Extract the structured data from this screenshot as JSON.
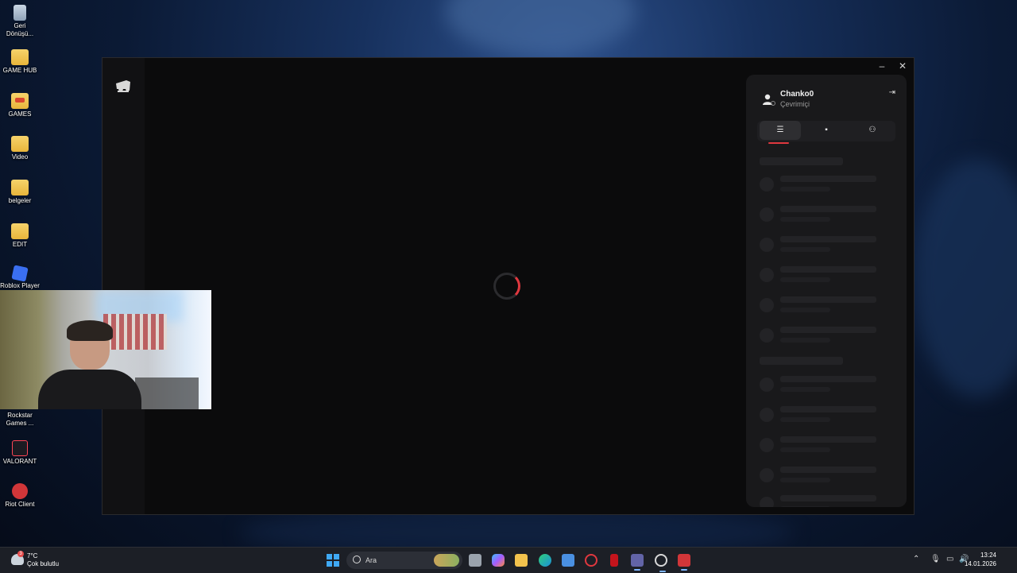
{
  "desktop": {
    "icons": [
      {
        "label": "Geri Dönüşü...",
        "icon": "recycle-bin-icon"
      },
      {
        "label": "GAME HUB",
        "icon": "folder-icon"
      },
      {
        "label": "GAMES",
        "icon": "folder-icon"
      },
      {
        "label": "Video",
        "icon": "folder-icon"
      },
      {
        "label": "belgeler",
        "icon": "folder-icon"
      },
      {
        "label": "EDIT",
        "icon": "folder-icon"
      },
      {
        "label": "Roblox Player",
        "icon": "roblox-icon"
      },
      {
        "label": "Rockstar Games ...",
        "icon": "rockstar-icon"
      },
      {
        "label": "VALORANT",
        "icon": "valorant-icon"
      },
      {
        "label": "Riot Client",
        "icon": "riot-client-icon"
      }
    ]
  },
  "window": {
    "minimize_label": "–",
    "close_label": "✕"
  },
  "social": {
    "username": "Chanko0",
    "status": "Çevrimiçi",
    "tabs": [
      {
        "name": "friends-list",
        "icon": "list-icon",
        "active": true
      },
      {
        "name": "messages",
        "icon": "chat-icon",
        "active": false
      },
      {
        "name": "add-friend",
        "icon": "add-person-icon",
        "active": false
      }
    ],
    "accent_color": "#e0383f"
  },
  "taskbar": {
    "weather_temp": "7°C",
    "weather_desc": "Çok bulutlu",
    "weather_badge": "3",
    "search_placeholder": "Ara",
    "time": "13:24",
    "date": "14.01.2026",
    "apps": [
      "start-icon",
      "task-view-icon",
      "copilot-icon",
      "file-explorer-icon",
      "edge-icon",
      "store-icon",
      "opera-icon",
      "netflix-icon",
      "teams-icon",
      "steam-icon",
      "riot-client-icon"
    ]
  }
}
